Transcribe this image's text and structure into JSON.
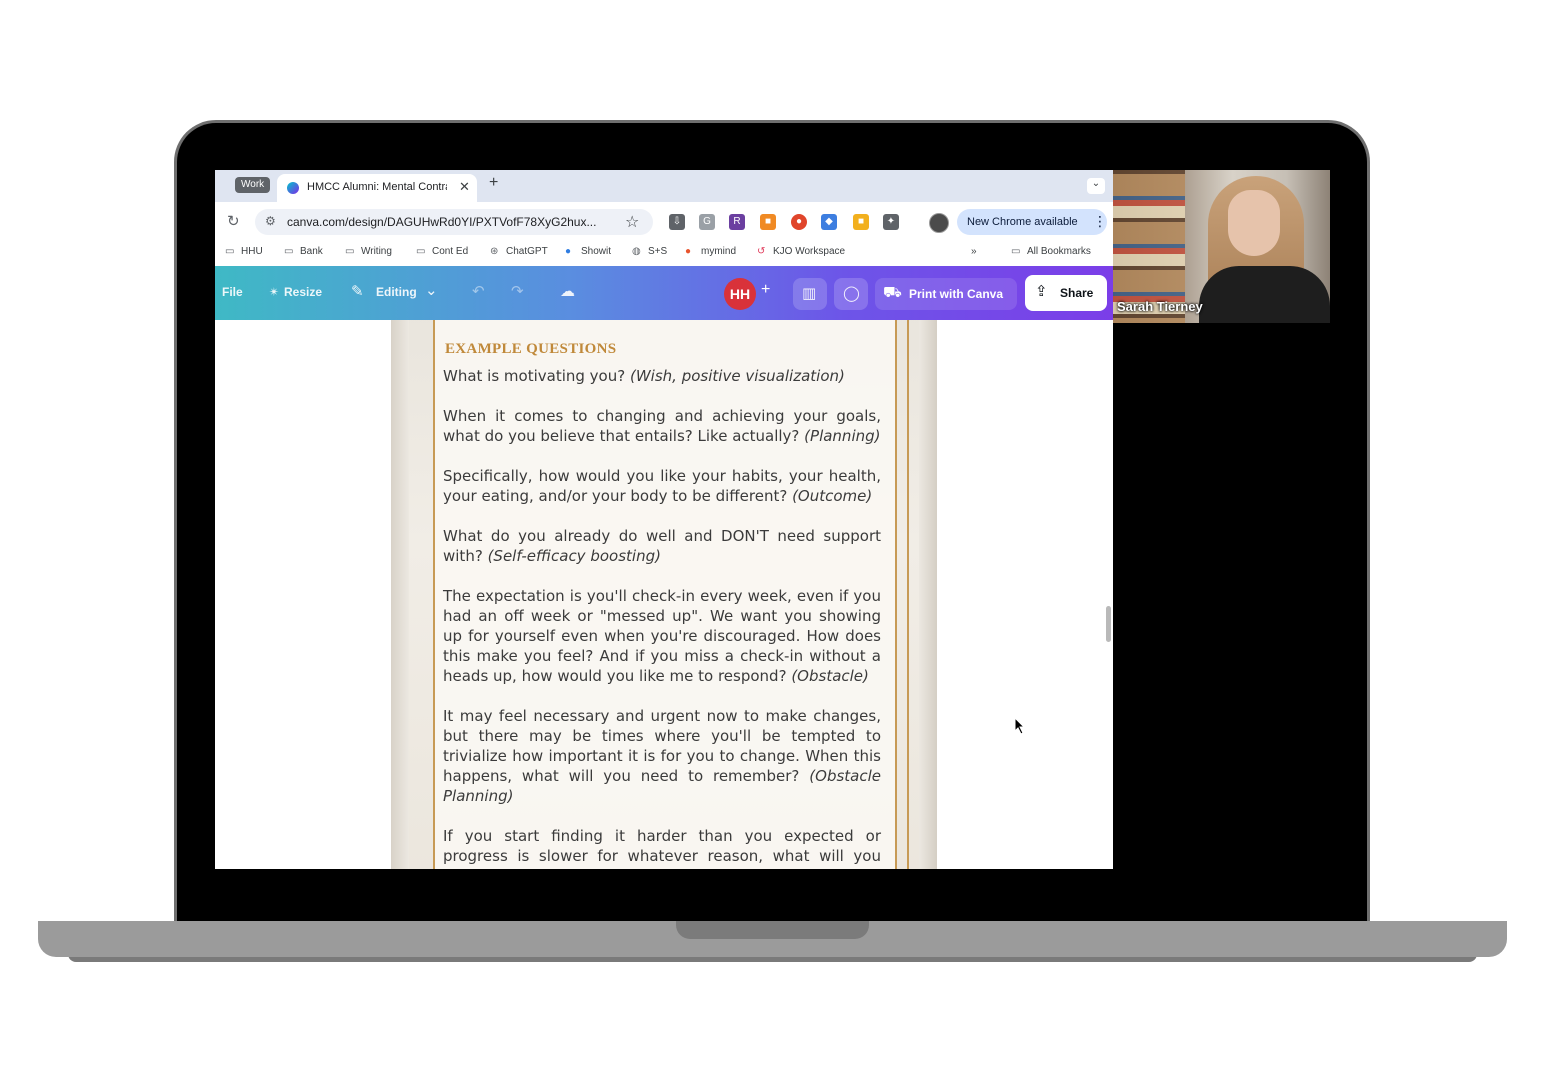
{
  "browser": {
    "tab_group": "Work",
    "tab_title": "HMCC Alumni: Mental Contra",
    "url": "canva.com/design/DAGUHwRd0YI/PXTVofF78XyG2hux...",
    "update_label": "New Chrome available",
    "bookmarks": [
      "HHU",
      "Bank",
      "Writing",
      "Cont Ed",
      "ChatGPT",
      "Showit",
      "S+S",
      "mymind",
      "KJO Workspace"
    ],
    "overflow_label": "»",
    "all_bookmarks": "All Bookmarks"
  },
  "canva": {
    "file_label": "File",
    "resize_label": "Resize",
    "editing_label": "Editing",
    "avatar_initials": "HH",
    "print_label": "Print with Canva",
    "share_label": "Share"
  },
  "document": {
    "heading": "EXAMPLE QUESTIONS",
    "questions": [
      {
        "text": "What is motivating you?",
        "tag": "(Wish, positive visualization)"
      },
      {
        "text": "When it comes to changing and achieving your goals, what do you believe that entails? Like actually?",
        "tag": "(Planning)"
      },
      {
        "text": "Specifically, how would you like your habits, your health, your eating, and/or your body to be different?",
        "tag": "(Outcome)"
      },
      {
        "text": "What do you already do well and DON'T need support with?",
        "tag": "(Self-efficacy boosting)"
      },
      {
        "text": "The expectation is you'll check-in every week, even if you had an off week or \"messed up\". We want you showing up for yourself even when you're discouraged. How does this make you feel? And if you miss a check-in without a heads up, how would you like me to respond?",
        "tag": "(Obstacle)"
      },
      {
        "text": "It may feel necessary and urgent now to make changes, but there may be times where you'll be tempted to trivialize how important it is for you to change. When this happens, what will you need to remember?",
        "tag": "(Obstacle Planning)"
      },
      {
        "text": "If you start finding it harder than you expected or progress is slower for whatever reason, what will you need to",
        "tag": ""
      }
    ]
  },
  "video": {
    "participant_name": "Sarah Tierney"
  }
}
